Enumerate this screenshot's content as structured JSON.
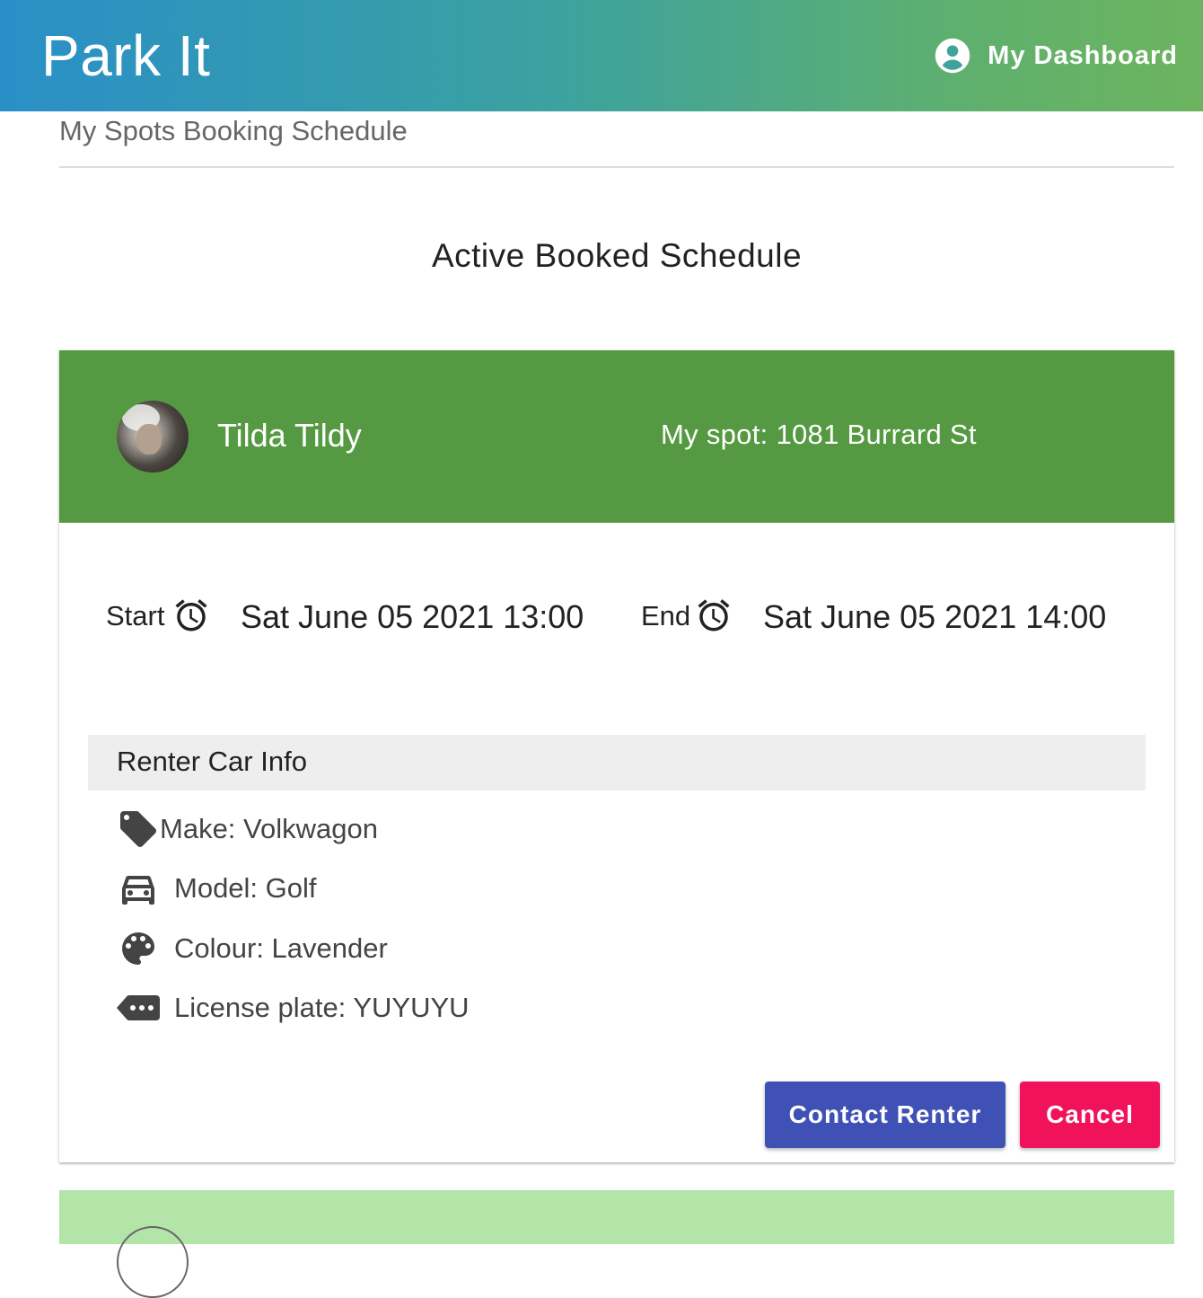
{
  "app": {
    "title": "Park It",
    "dashboard_label": "My Dashboard"
  },
  "page": {
    "subtitle": "My Spots Booking Schedule",
    "section_title": "Active Booked Schedule"
  },
  "booking": {
    "renter_name": "Tilda Tildy",
    "spot": "My spot: 1081 Burrard St",
    "start_label": "Start",
    "start_value": "Sat June 05 2021 13:00",
    "end_label": "End",
    "end_value": "Sat June 05 2021 14:00",
    "car_info_title": "Renter Car Info",
    "car": {
      "make": "Make: Volkwagon",
      "model": "Model: Golf",
      "colour": "Colour: Lavender",
      "plate": "License plate: YUYUYU"
    },
    "contact_label": "Contact Renter",
    "cancel_label": "Cancel"
  },
  "colors": {
    "appbar_start": "#2a8fc7",
    "appbar_end": "#6cb45f",
    "card_header": "#559a42",
    "next_card_header": "#b3e4a8",
    "contact_button": "#3f51b5",
    "cancel_button": "#f0125a"
  },
  "icons": {
    "account": "account-circle-icon",
    "alarm": "alarm-icon",
    "tag": "tag-icon",
    "car": "car-icon",
    "palette": "palette-icon",
    "plate": "more-tag-icon"
  }
}
